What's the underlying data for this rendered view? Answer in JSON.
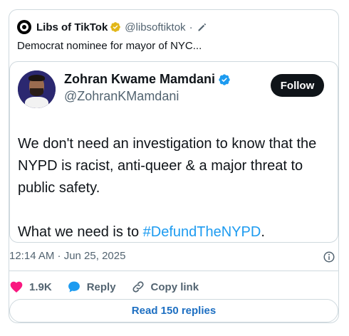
{
  "quote": {
    "name": "Libs of TikTok",
    "handle": "@libsoftiktok",
    "separator": "·",
    "text": "Democrat nominee for mayor of NYC..."
  },
  "tweet": {
    "name": "Zohran Kwame Mamdani",
    "handle": "@ZohranKMamdani",
    "follow_label": "Follow",
    "line1": "We don't need an investigation to know that the NYPD is racist, anti-queer & a major threat to public safety.",
    "line2_prefix": "What we need is to ",
    "hashtag": "#DefundTheNYPD",
    "line2_suffix": "."
  },
  "meta": {
    "timestamp": "12:14 AM · Jun 25, 2025"
  },
  "actions": {
    "likes": "1.9K",
    "reply_label": "Reply",
    "copy_label": "Copy link"
  },
  "read_replies_label": "Read 150 replies",
  "colors": {
    "accent": "#1d9bf0",
    "like": "#f91880",
    "verified_gold": "#e2b719",
    "text": "#0f1419",
    "muted": "#536471"
  }
}
